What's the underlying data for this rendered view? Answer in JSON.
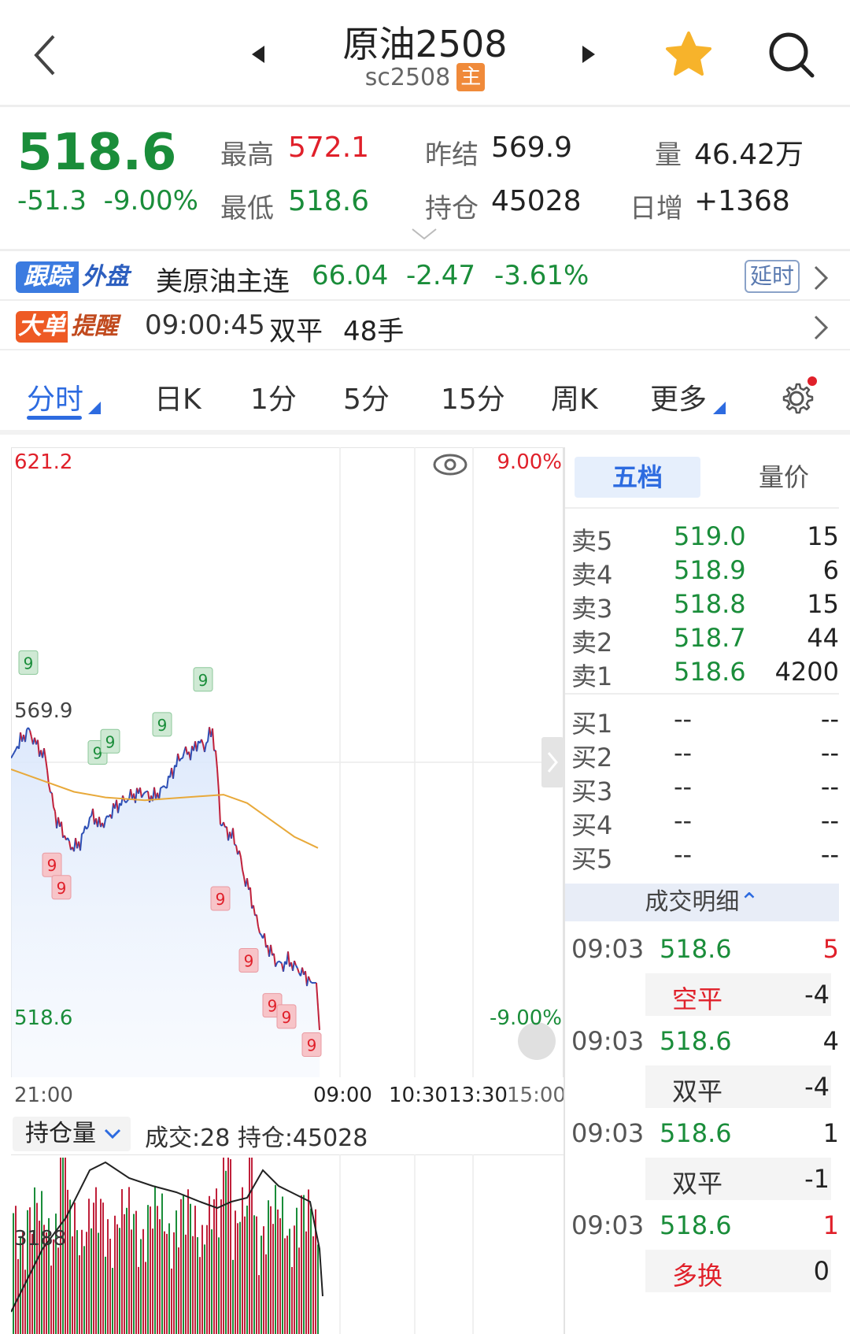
{
  "header": {
    "title": "原油2508",
    "code": "sc2508",
    "badge": "主"
  },
  "quote": {
    "price": "518.6",
    "change": "-51.3",
    "change_pct": "-9.00%",
    "high_label": "最高",
    "high": "572.1",
    "low_label": "最低",
    "low": "518.6",
    "prev_label": "昨结",
    "prev": "569.9",
    "oi_label": "持仓",
    "oi": "45028",
    "vol_label": "量",
    "vol": "46.42万",
    "inc_label": "日增",
    "inc": "+1368"
  },
  "track": {
    "tag1": "跟踪",
    "tag2": "外盘",
    "name": "美原油主连",
    "price": "66.04",
    "change": "-2.47",
    "pct": "-3.61%",
    "delay": "延时"
  },
  "alert": {
    "tag1": "大单",
    "tag2": "提醒",
    "time": "09:00:45",
    "type": "双平",
    "qty": "48手"
  },
  "tabs": [
    "分时",
    "日K",
    "1分",
    "5分",
    "15分",
    "周K",
    "更多"
  ],
  "chart": {
    "y_high": "621.2",
    "y_mid": "569.9",
    "y_low": "518.6",
    "pct_high": "9.00%",
    "pct_low": "-9.00%",
    "x_labels": [
      "21:00",
      "09:00",
      "10:30",
      "13:30",
      "15:00"
    ],
    "markers": [
      "9",
      "9",
      "9",
      "9",
      "9",
      "9",
      "9",
      "9",
      "9",
      "9",
      "9",
      "9",
      "9"
    ],
    "oi_selector": "持仓量",
    "sub_info": "成交:28 持仓:45028",
    "sub_level": "3188"
  },
  "panel": {
    "tab_active": "五档",
    "tab_other": "量价",
    "asks": [
      {
        "label": "卖5",
        "price": "519.0",
        "vol": "15"
      },
      {
        "label": "卖4",
        "price": "518.9",
        "vol": "6"
      },
      {
        "label": "卖3",
        "price": "518.8",
        "vol": "15"
      },
      {
        "label": "卖2",
        "price": "518.7",
        "vol": "44"
      },
      {
        "label": "卖1",
        "price": "518.6",
        "vol": "4200"
      }
    ],
    "bids": [
      {
        "label": "买1",
        "price": "--",
        "vol": "--"
      },
      {
        "label": "买2",
        "price": "--",
        "vol": "--"
      },
      {
        "label": "买3",
        "price": "--",
        "vol": "--"
      },
      {
        "label": "买4",
        "price": "--",
        "vol": "--"
      },
      {
        "label": "买5",
        "price": "--",
        "vol": "--"
      }
    ],
    "trades_header": "成交明细",
    "trades": [
      {
        "time": "09:03",
        "price": "518.6",
        "qty": "5",
        "type": "空平",
        "oi": "-4"
      },
      {
        "time": "09:03",
        "price": "518.6",
        "qty": "4",
        "type": "双平",
        "oi": "-4"
      },
      {
        "time": "09:03",
        "price": "518.6",
        "qty": "1",
        "type": "双平",
        "oi": "-1"
      },
      {
        "time": "09:03",
        "price": "518.6",
        "qty": "1",
        "type": "多换",
        "oi": "0"
      }
    ]
  },
  "colors": {
    "up": "#e0202a",
    "down": "#1a8d3a",
    "accent": "#2d6be0",
    "avg_line": "#e8a93a"
  }
}
